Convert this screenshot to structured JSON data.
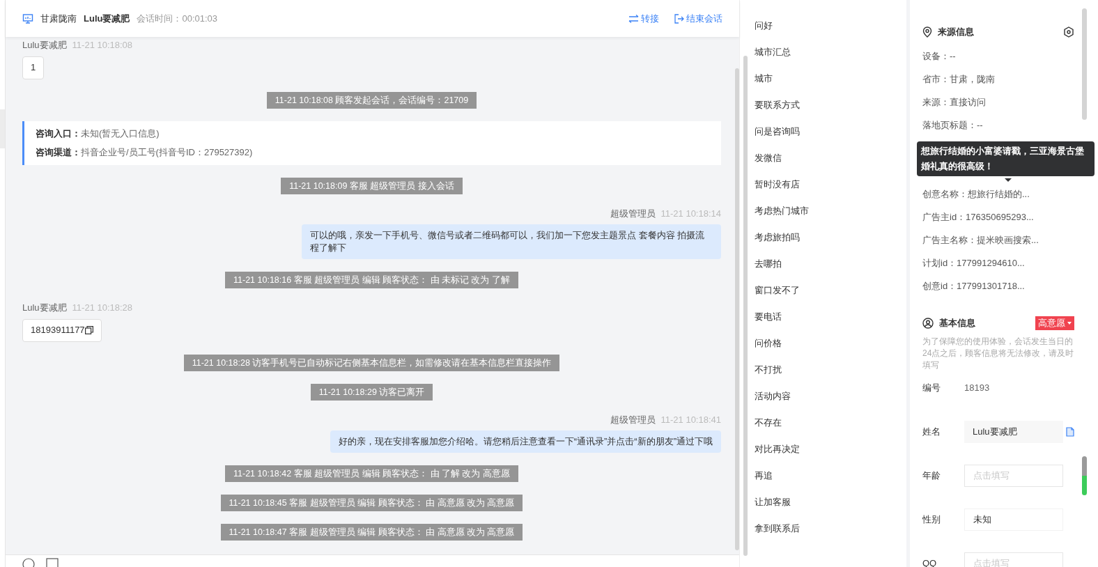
{
  "header": {
    "location": "甘肃陇南",
    "customer": "Lulu要减肥",
    "duration_label": "会话时间：",
    "duration": "00:01:03",
    "actions": [
      {
        "label": "转接",
        "kind": "transfer"
      },
      {
        "label": "结束会话",
        "kind": "end"
      }
    ]
  },
  "messages": [
    {
      "kind": "customer",
      "name": "Lulu要减肥",
      "time": "11-21 10:18:08",
      "text": "1",
      "copyable": false
    },
    {
      "kind": "system",
      "text": "11-21 10:18:08 顾客发起会话，会话编号：21709"
    },
    {
      "kind": "entry",
      "lines": [
        {
          "label": "咨询入口：",
          "value": "未知(暂无入口信息)"
        },
        {
          "label": "咨询渠道：",
          "value": "抖音企业号/员工号(抖音号ID：279527392)"
        }
      ]
    },
    {
      "kind": "system",
      "text": "11-21 10:18:09 客服 超级管理员 接入会话"
    },
    {
      "kind": "agent",
      "name": "超级管理员",
      "time": "11-21 10:18:14",
      "text": "可以的哦，亲发一下手机号、微信号或者二维码都可以，我们加一下您发主题景点 套餐内容 拍摄流程了解下"
    },
    {
      "kind": "system",
      "text": "11-21 10:18:16 客服 超级管理员 编辑 顾客状态： 由 未标记 改为 了解"
    },
    {
      "kind": "customer",
      "name": "Lulu要减肥",
      "time": "11-21 10:18:28",
      "text": "18193911177",
      "copyable": true
    },
    {
      "kind": "system",
      "text": "11-21 10:18:28 访客手机号已自动标记右侧基本信息栏，如需修改请在基本信息栏直接操作"
    },
    {
      "kind": "system",
      "text": "11-21 10:18:29 访客已离开"
    },
    {
      "kind": "agent",
      "name": "超级管理员",
      "time": "11-21 10:18:41",
      "text": "好的亲，现在安排客服加您介绍哈。请您稍后注意查看一下“通讯录”并点击“新的朋友”通过下哦"
    },
    {
      "kind": "system",
      "text": "11-21 10:18:42 客服 超级管理员 编辑 顾客状态： 由 了解 改为 高意愿"
    },
    {
      "kind": "system",
      "text": "11-21 10:18:45 客服 超级管理员 编辑 顾客状态： 由 高意愿 改为 高意愿"
    },
    {
      "kind": "system",
      "text": "11-21 10:18:47 客服 超级管理员 编辑 顾客状态： 由 高意愿 改为 高意愿"
    }
  ],
  "quick_replies": [
    "问好",
    "城市汇总",
    "城市",
    "要联系方式",
    "问是咨询吗",
    "发微信",
    "暂时没有店",
    "考虑热门城市",
    "考虑旅拍吗",
    "去哪拍",
    "窗口发不了",
    "要电话",
    "问价格",
    "不打扰",
    "活动内容",
    "不存在",
    "对比再决定",
    "再追",
    "让加客服",
    "拿到联系后"
  ],
  "source_info": {
    "title": "来源信息",
    "rows_before": [
      "设备：--",
      "省市：甘肃，陇南",
      "来源：直接访问",
      "落地页标题：--"
    ],
    "tooltip": "想旅行结婚的小富婆请戳，三亚海景古堡婚礼真的很高级！",
    "rows_after": [
      "创意名称：想旅行结婚的...",
      "广告主id：176350695293...",
      "广告主名称：提米映画搜索...",
      "计划id：177991294610...",
      "创意id：177991301718..."
    ]
  },
  "basic_info": {
    "title": "基本信息",
    "status": "高意愿",
    "notice": "为了保障您的使用体验，会话发生当日的24点之后，顾客信息将无法修改，请及时填写",
    "fields": [
      {
        "kind": "text",
        "label": "编号",
        "value": "18193"
      },
      {
        "kind": "readonly",
        "label": "姓名",
        "value": "Lulu要减肥"
      },
      {
        "kind": "input",
        "label": "年龄",
        "placeholder": "点击填写"
      },
      {
        "kind": "select",
        "label": "性别",
        "value": "未知"
      },
      {
        "kind": "input",
        "label": "QQ",
        "placeholder": "点击填写"
      }
    ]
  }
}
